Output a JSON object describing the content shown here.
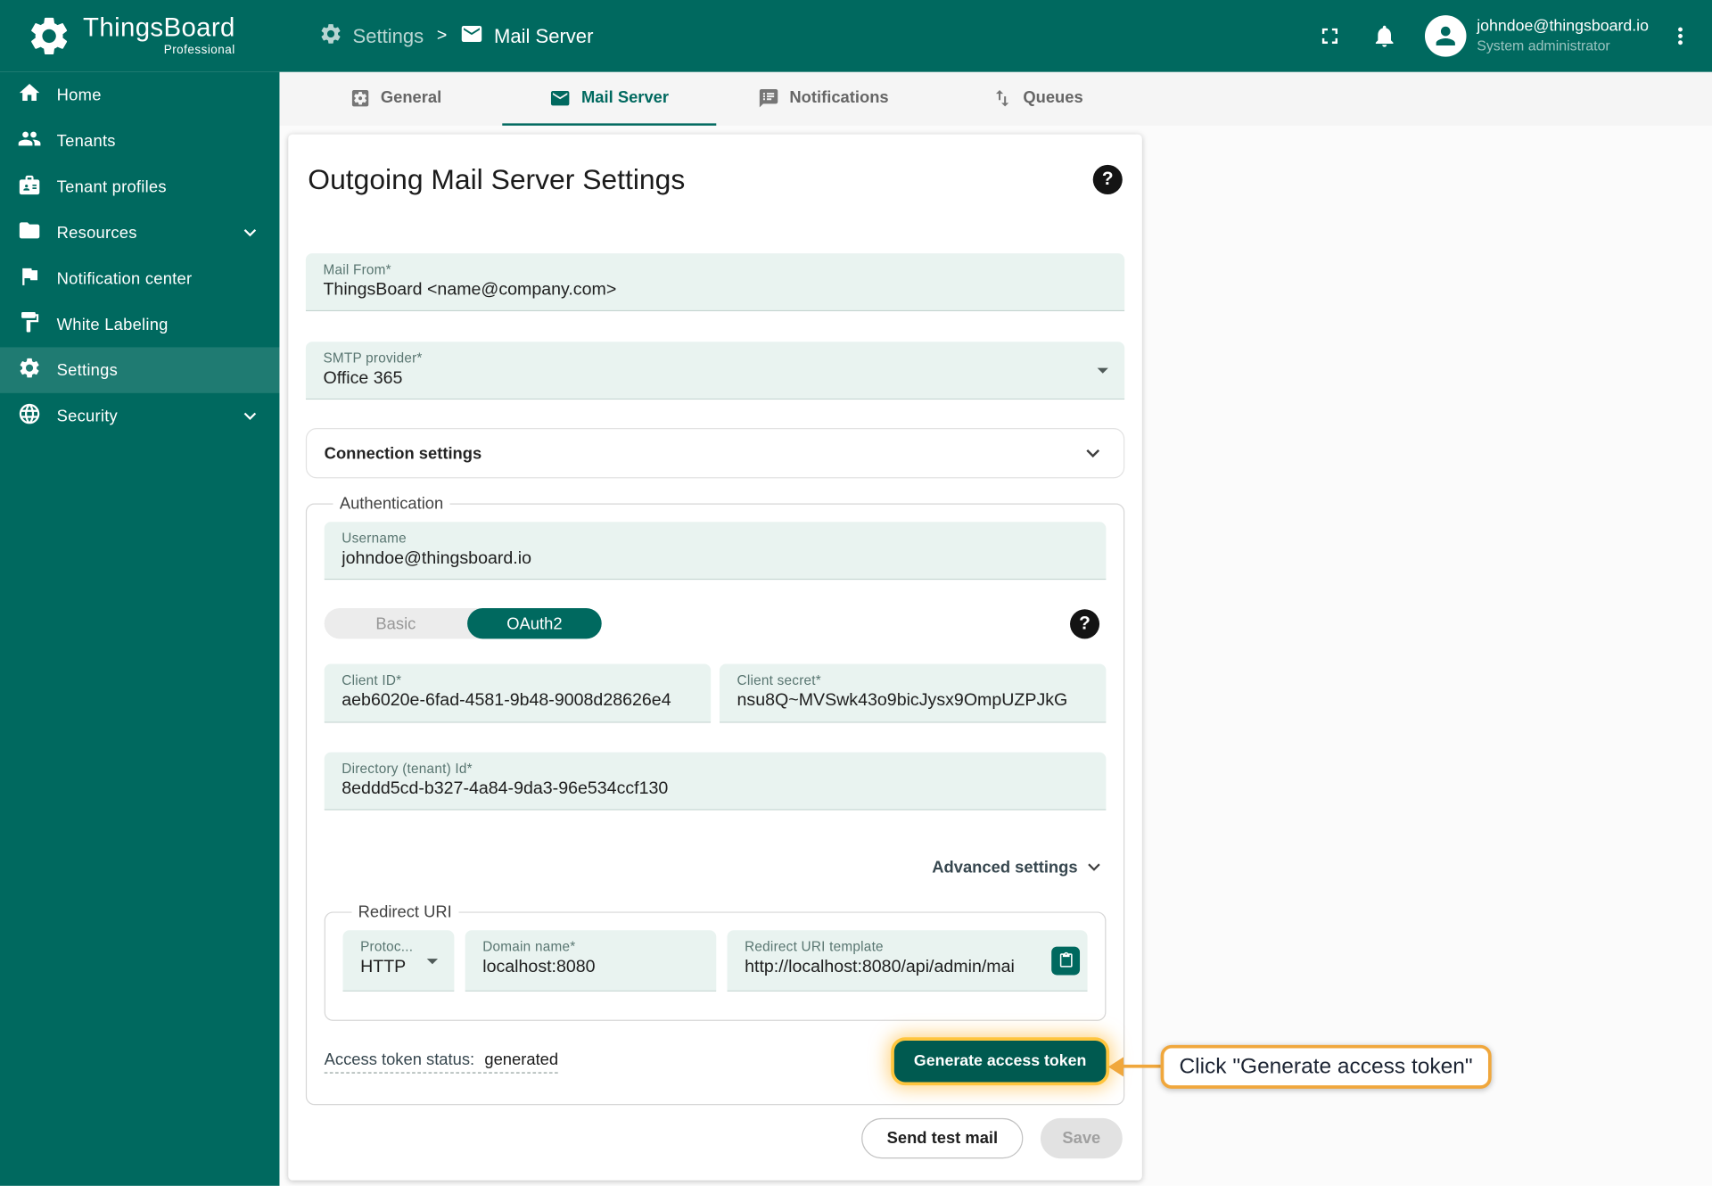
{
  "header": {
    "brand": {
      "name": "ThingsBoard",
      "subtitle": "Professional"
    },
    "breadcrumb": {
      "section": "Settings",
      "separator": ">",
      "page": "Mail Server"
    },
    "user": {
      "email": "johndoe@thingsboard.io",
      "role": "System administrator"
    }
  },
  "sidebar": {
    "items": [
      {
        "label": "Home"
      },
      {
        "label": "Tenants"
      },
      {
        "label": "Tenant profiles"
      },
      {
        "label": "Resources"
      },
      {
        "label": "Notification center"
      },
      {
        "label": "White Labeling"
      },
      {
        "label": "Settings"
      },
      {
        "label": "Security"
      }
    ]
  },
  "tabs": [
    {
      "label": "General"
    },
    {
      "label": "Mail Server"
    },
    {
      "label": "Notifications"
    },
    {
      "label": "Queues"
    }
  ],
  "form": {
    "title": "Outgoing Mail Server Settings",
    "fields": {
      "mail_from": {
        "label": "Mail From*",
        "value": "ThingsBoard <name@company.com>"
      },
      "smtp_provider": {
        "label": "SMTP provider*",
        "value": "Office 365"
      }
    },
    "connection_settings_label": "Connection settings",
    "authentication": {
      "legend": "Authentication",
      "username": {
        "label": "Username",
        "value": "johndoe@thingsboard.io"
      },
      "auth_type": {
        "basic": "Basic",
        "oauth2": "OAuth2",
        "selected": "OAuth2"
      },
      "client_id": {
        "label": "Client ID*",
        "value": "aeb6020e-6fad-4581-9b48-9008d28626e4"
      },
      "client_secret": {
        "label": "Client secret*",
        "value": "nsu8Q~MVSwk43o9bicJysx9OmpUZPJkG"
      },
      "directory_id": {
        "label": "Directory (tenant) Id*",
        "value": "8eddd5cd-b327-4a84-9da3-96e534ccf130"
      },
      "advanced_settings_label": "Advanced settings",
      "redirect_uri": {
        "legend": "Redirect URI",
        "protocol": {
          "label": "Protoc...",
          "value": "HTTP"
        },
        "domain": {
          "label": "Domain name*",
          "value": "localhost:8080"
        },
        "template": {
          "label": "Redirect URI template",
          "value": "http://localhost:8080/api/admin/mai"
        }
      },
      "access_token": {
        "label": "Access token status:",
        "value": "generated",
        "button": "Generate access token"
      }
    },
    "actions": {
      "send_test_mail": "Send test mail",
      "save": "Save"
    }
  },
  "annotation": {
    "text": "Click \"Generate access token\""
  },
  "icons": {
    "help_glyph": "?"
  },
  "colors": {
    "primary": "#00695f",
    "primary_dark": "#005a50",
    "accent_highlight": "#f0a73c",
    "field_bg": "#e9f3f0"
  }
}
